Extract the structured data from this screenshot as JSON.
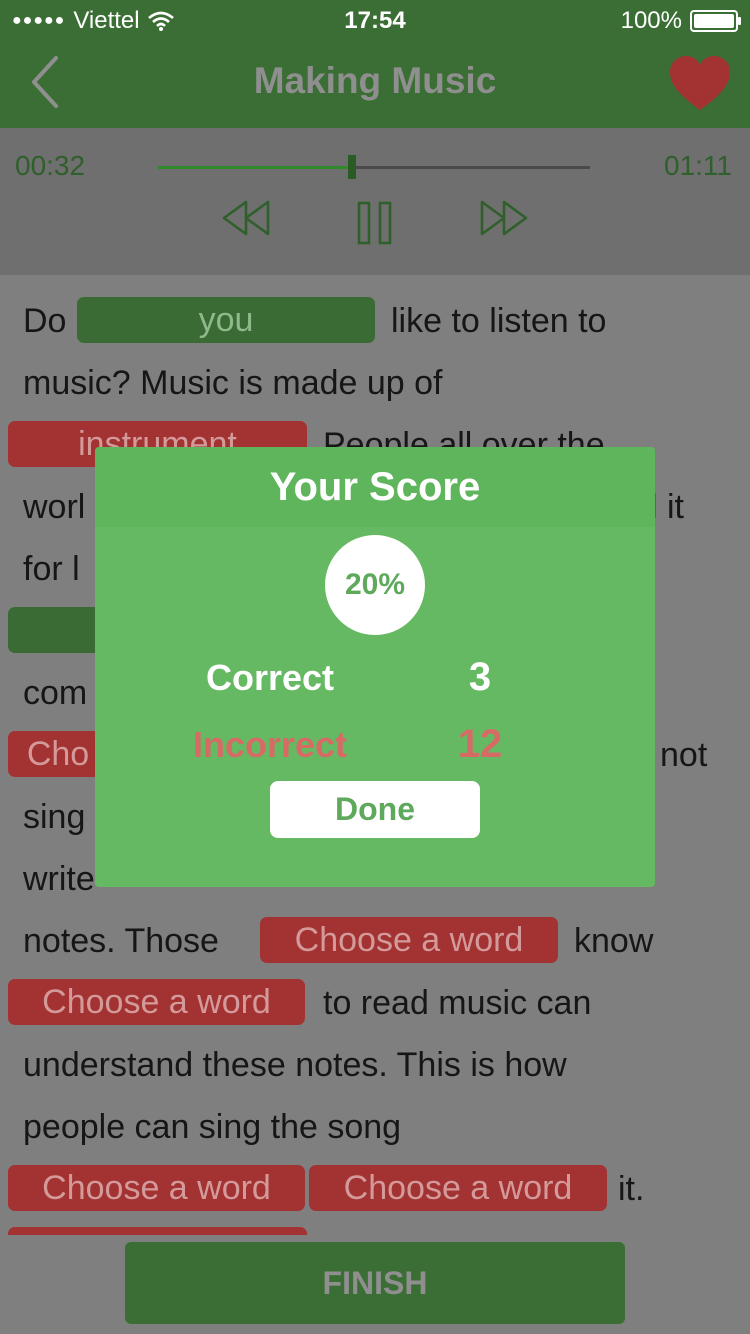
{
  "status": {
    "carrier": "Viettel",
    "time": "17:54",
    "battery": "100%"
  },
  "nav": {
    "title": "Making Music"
  },
  "player": {
    "current": "00:32",
    "total": "01:11",
    "progress": 0.45
  },
  "passage": {
    "l1a": "Do",
    "l1b": "like  to  listen  to",
    "l2": "music?  Music  is  made  up  of",
    "l3b": "People  all  over  the",
    "l4a": "worl",
    "l4b": "l  it",
    "l5a": "for  l",
    "l7a": "com",
    "l8b": "not",
    "l9a": "sing",
    "l10a": "write",
    "l11a": "notes.  Those",
    "l11b": "know",
    "l12b": "to  read  music  can",
    "l13": "understand  these  notes.  This  is  how",
    "l14": "people  can  sing  the  song",
    "l15b": "it."
  },
  "blanks": {
    "b1": "you",
    "b2": "instrument",
    "b3": "Cho",
    "placeholder": "Choose a word"
  },
  "modal": {
    "title": "Your Score",
    "percent": "20%",
    "correct_label": "Correct",
    "correct_value": "3",
    "incorrect_label": "Incorrect",
    "incorrect_value": "12",
    "done": "Done"
  },
  "finish": "FINISH"
}
